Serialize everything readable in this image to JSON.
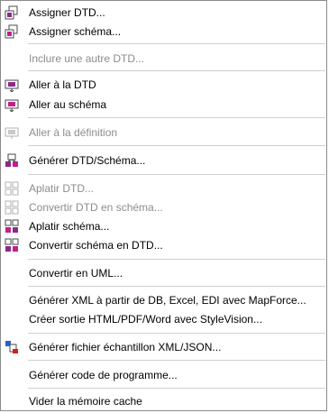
{
  "menu": {
    "items": [
      {
        "label": "Assigner DTD...",
        "icon": "assign-dtd-icon",
        "disabled": false
      },
      {
        "label": "Assigner schéma...",
        "icon": "assign-schema-icon",
        "disabled": false
      },
      {
        "label": "Inclure une autre DTD...",
        "icon": "",
        "disabled": true
      },
      {
        "label": "Aller à la DTD",
        "icon": "goto-dtd-icon",
        "disabled": false
      },
      {
        "label": "Aller au schéma",
        "icon": "goto-schema-icon",
        "disabled": false
      },
      {
        "label": "Aller à la définition",
        "icon": "goto-definition-icon",
        "disabled": true
      },
      {
        "label": "Générer DTD/Schéma...",
        "icon": "generate-dtd-schema-icon",
        "disabled": false
      },
      {
        "label": "Aplatir DTD...",
        "icon": "flatten-dtd-icon",
        "disabled": true
      },
      {
        "label": "Convertir DTD en schéma...",
        "icon": "convert-dtd-schema-icon",
        "disabled": true
      },
      {
        "label": "Aplatir schéma...",
        "icon": "flatten-schema-icon",
        "disabled": false
      },
      {
        "label": "Convertir schéma en DTD...",
        "icon": "convert-schema-dtd-icon",
        "disabled": false
      },
      {
        "label": "Convertir en UML...",
        "icon": "",
        "disabled": false
      },
      {
        "label": "Générer XML à partir de DB, Excel, EDI avec MapForce...",
        "icon": "",
        "disabled": false
      },
      {
        "label": "Créer sortie HTML/PDF/Word avec StyleVision...",
        "icon": "",
        "disabled": false
      },
      {
        "label": "Générer fichier échantillon XML/JSON...",
        "icon": "generate-sample-icon",
        "disabled": false
      },
      {
        "label": "Générer code de programme...",
        "icon": "",
        "disabled": false
      },
      {
        "label": "Vider la mémoire cache",
        "icon": "",
        "disabled": false
      }
    ]
  }
}
